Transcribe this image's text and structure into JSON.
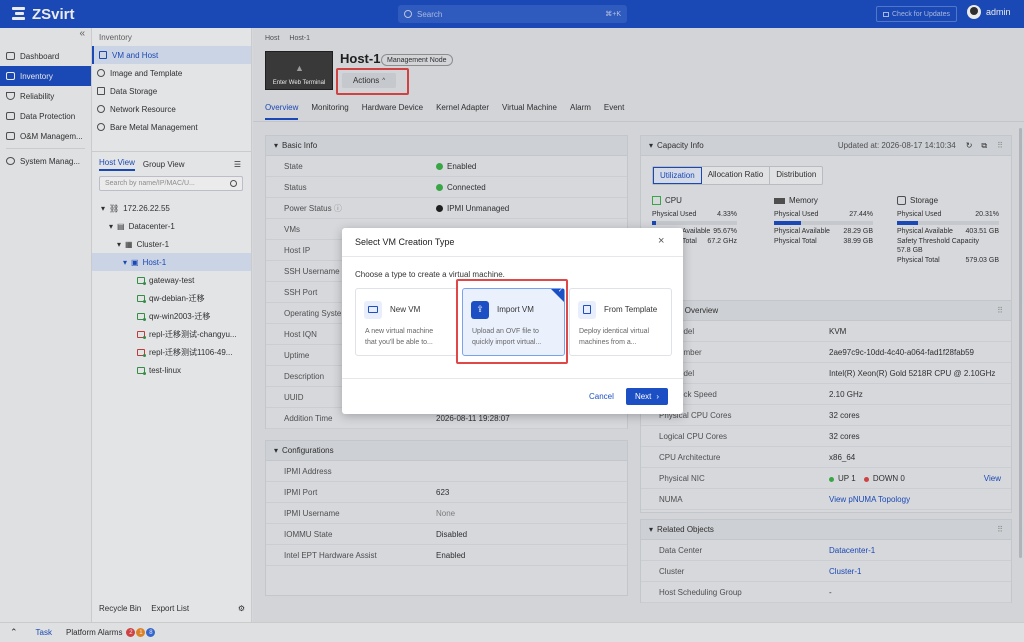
{
  "app": {
    "name": "ZSvirt",
    "search_placeholder": "Search",
    "search_shortcut": "⌘+K",
    "check_updates": "Check for Updates",
    "user": "admin"
  },
  "nav": {
    "items": [
      {
        "label": "Dashboard"
      },
      {
        "label": "Inventory"
      },
      {
        "label": "Reliability"
      },
      {
        "label": "Data Protection"
      },
      {
        "label": "O&M Managem..."
      },
      {
        "label": "System Manag..."
      }
    ]
  },
  "sub": {
    "title": "Inventory",
    "items": [
      {
        "label": "VM and Host"
      },
      {
        "label": "Image and Template"
      },
      {
        "label": "Data Storage"
      },
      {
        "label": "Network Resource"
      },
      {
        "label": "Bare Metal Management"
      }
    ],
    "views": [
      "Host View",
      "Group View"
    ],
    "filter_placeholder": "Search by name/IP/MAC/U...",
    "tree": {
      "network": "172.26.22.55",
      "datacenter": "Datacenter-1",
      "cluster": "Cluster-1",
      "host": "Host-1",
      "vms": [
        "gateway-test",
        "qw-debian-迁移",
        "qw-win2003-迁移",
        "repl-迁移测试-changyu...",
        "repl-迁移测试1106-49...",
        "test-linux"
      ]
    },
    "footer": [
      "Recycle Bin",
      "Export List"
    ]
  },
  "breadcrumb": [
    "Host",
    "Host-1"
  ],
  "host": {
    "title": "Host-1",
    "badge": "Management Node",
    "terminal": "Enter Web Terminal",
    "actions": "Actions"
  },
  "tabs": [
    "Overview",
    "Monitoring",
    "Hardware Device",
    "Kernel Adapter",
    "Virtual Machine",
    "Alarm",
    "Event"
  ],
  "basic": {
    "title": "Basic Info",
    "rows": [
      {
        "k": "State",
        "v": "Enabled"
      },
      {
        "k": "Status",
        "v": "Connected"
      },
      {
        "k": "Power Status",
        "v": "IPMI Unmanaged"
      },
      {
        "k": "VMs",
        "v": ""
      },
      {
        "k": "Host IP",
        "v": ""
      },
      {
        "k": "SSH Username",
        "v": ""
      },
      {
        "k": "SSH Port",
        "v": ""
      },
      {
        "k": "Operating Syste",
        "v": ""
      },
      {
        "k": "Host IQN",
        "v": ""
      },
      {
        "k": "Uptime",
        "v": ""
      },
      {
        "k": "Description",
        "v": ""
      },
      {
        "k": "UUID",
        "v": ""
      },
      {
        "k": "Addition Time",
        "v": "2026-08-11 19:28:07"
      }
    ]
  },
  "config": {
    "title": "Configurations",
    "rows": [
      {
        "k": "IPMI Address",
        "v": ""
      },
      {
        "k": "IPMI Port",
        "v": "623"
      },
      {
        "k": "IPMI Username",
        "v": "None"
      },
      {
        "k": "IOMMU State",
        "v": "Disabled"
      },
      {
        "k": "Intel EPT Hardware Assist",
        "v": "Enabled"
      }
    ]
  },
  "capacity": {
    "title": "Capacity Info",
    "updated": "Updated at: 2026-08-17 14:10:34",
    "tabs": [
      "Utilization",
      "Allocation Ratio",
      "Distribution"
    ],
    "cpu": {
      "title": "CPU",
      "used_label": "Physical Used",
      "used": "4.33%",
      "avail_label": "Available",
      "avail": "95.67%",
      "total_label": "Total",
      "total": "67.2 GHz",
      "fill": 0.0433
    },
    "mem": {
      "title": "Memory",
      "used_label": "Physical Used",
      "used": "27.44%",
      "avail_label": "Physical Available",
      "avail": "28.29 GB",
      "total_label": "Physical Total",
      "total": "38.99 GB",
      "fill": 0.2744
    },
    "sto": {
      "title": "Storage",
      "used_label": "Physical Used",
      "used": "20.31%",
      "avail_label": "Physical Available",
      "avail": "403.51 GB",
      "thr_label": "Safety Threshold Capacity",
      "thr": "57.8 GB",
      "total_label": "Physical Total",
      "total": "579.03 GB",
      "fill": 0.2031
    }
  },
  "hardware": {
    "title": "are Overview",
    "rows": [
      {
        "k": "odel",
        "v": "KVM"
      },
      {
        "k": "umber",
        "v": "2ae97c9c-10dd-4c40-a064-fad1f28fab59"
      },
      {
        "k": "odel",
        "v": "Intel(R) Xeon(R) Gold 5218R CPU @ 2.10GHz"
      },
      {
        "k": "ock Speed",
        "v": "2.10 GHz"
      },
      {
        "k": "Physical CPU Cores",
        "v": "32 cores"
      },
      {
        "k": "Logical CPU Cores",
        "v": "32 cores"
      },
      {
        "k": "CPU Architecture",
        "v": "x86_64"
      },
      {
        "k": "Physical NIC",
        "v": ""
      },
      {
        "k": "NUMA",
        "v": "View pNUMA Topology"
      }
    ],
    "nic": {
      "up": "UP 1",
      "down": "DOWN 0",
      "view": "View"
    }
  },
  "related": {
    "title": "Related Objects",
    "rows": [
      {
        "k": "Data Center",
        "v": "Datacenter-1"
      },
      {
        "k": "Cluster",
        "v": "Cluster-1"
      },
      {
        "k": "Host Scheduling Group",
        "v": "-"
      }
    ]
  },
  "dialog": {
    "title": "Select VM Creation Type",
    "subtitle": "Choose a type to create a virtual machine.",
    "cards": [
      {
        "title": "New VM",
        "desc1": "A new virtual machine",
        "desc2": "that you'll be able to..."
      },
      {
        "title": "Import VM",
        "desc1": "Upload an OVF file to",
        "desc2": "quickly import virtual..."
      },
      {
        "title": "From Template",
        "desc1": "Deploy identical virtual",
        "desc2": "machines from a..."
      }
    ],
    "cancel": "Cancel",
    "next": "Next"
  },
  "bottom": {
    "task": "Task",
    "alarms": "Platform Alarms",
    "c1": "2",
    "c2": "1",
    "c3": "8"
  },
  "colors": {
    "brand": "#1d4fc4",
    "ok": "#3db54a",
    "danger": "#e04848"
  }
}
